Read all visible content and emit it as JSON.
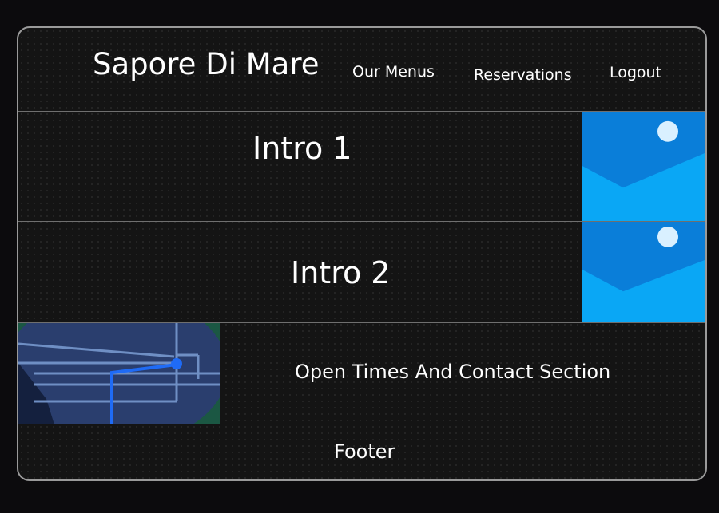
{
  "header": {
    "title": "Sapore Di Mare",
    "nav": {
      "menus": "Our Menus",
      "reservations": "Reservations",
      "logout": "Logout"
    }
  },
  "intro1": {
    "title": "Intro 1",
    "image_icon": "image-placeholder-icon"
  },
  "intro2": {
    "title": "Intro 2",
    "image_icon": "image-placeholder-icon"
  },
  "contact": {
    "title": "Open Times And Contact Section",
    "image_icon": "map-icon"
  },
  "footer": {
    "label": "Footer"
  },
  "colors": {
    "background": "#141414",
    "border": "#9a9a9a",
    "divider": "#6f6f6f",
    "text": "#ffffff",
    "image_light": "#0aa7f5",
    "image_dark": "#0a7ed9"
  }
}
